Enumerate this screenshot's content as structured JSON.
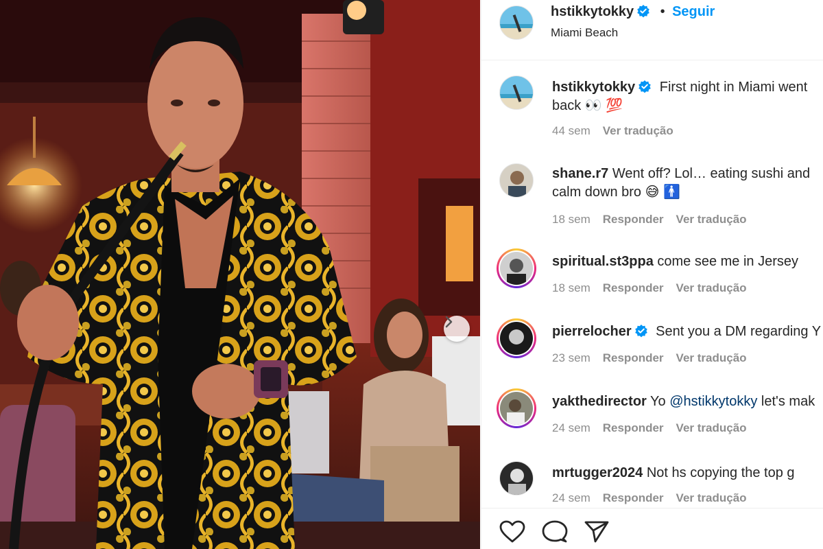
{
  "post": {
    "author": "hstikkytokky",
    "follow_label": "Seguir",
    "separator": "•",
    "location": "Miami Beach"
  },
  "caption": {
    "username": "hstikkytokky",
    "text_line1": "First night in Miami went",
    "text_line2": "back 👀 💯",
    "age": "44 sem",
    "translate": "Ver tradução"
  },
  "comments": [
    {
      "username": "shane.r7",
      "text_line1": "Went off? Lol… eating sushi and",
      "text_line2": "calm down bro 😅 🚹",
      "age": "18 sem",
      "reply": "Responder",
      "translate": "Ver tradução"
    },
    {
      "username": "spiritual.st3ppa",
      "text_line1": "come see me in Jersey",
      "age": "18 sem",
      "reply": "Responder",
      "translate": "Ver tradução"
    },
    {
      "username": "pierrelocher",
      "text_line1": "Sent you a DM regarding Y",
      "age": "23 sem",
      "reply": "Responder",
      "translate": "Ver tradução"
    },
    {
      "username": "yakthedirector",
      "text_prefix": "Yo",
      "mention": "@hstikkytokky",
      "text_suffix": "let's mak",
      "age": "24 sem",
      "reply": "Responder",
      "translate": "Ver tradução"
    },
    {
      "username": "mrtugger2024",
      "text_line1": "Not hs copying the top g",
      "age": "24 sem",
      "reply": "Responder",
      "translate": "Ver tradução"
    }
  ],
  "icons": {
    "verified": "verified-badge-icon",
    "next": "chevron-right-icon",
    "like": "heart-icon",
    "comment": "comment-bubble-icon",
    "share": "paper-plane-icon"
  },
  "colors": {
    "link_blue": "#0095f6",
    "verified_blue": "#0095f6",
    "meta_gray": "#8e8e8e",
    "text": "#262626"
  }
}
